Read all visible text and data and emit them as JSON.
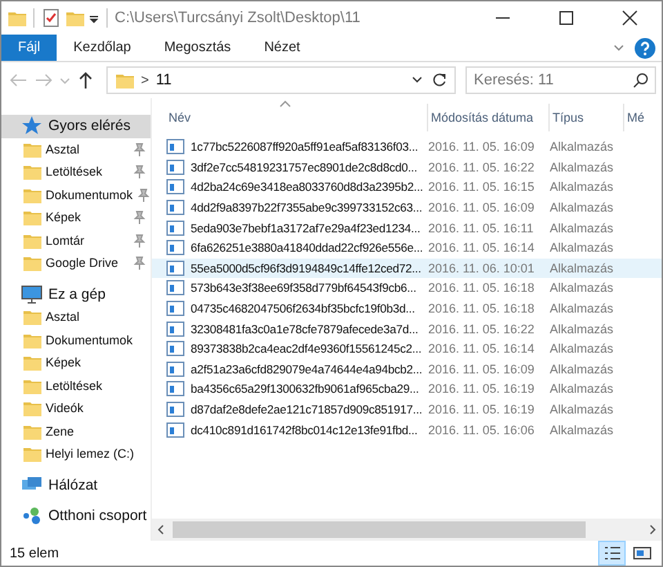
{
  "window": {
    "title": "C:\\Users\\Turcsányi Zsolt\\Desktop\\11"
  },
  "ribbon_tabs": [
    {
      "label": "Fájl",
      "kind": "file"
    },
    {
      "label": "Kezdőlap",
      "kind": "tab"
    },
    {
      "label": "Megosztás",
      "kind": "tab"
    },
    {
      "label": "Nézet",
      "kind": "tab"
    }
  ],
  "address_bar": {
    "separator": ">",
    "path": "11"
  },
  "search": {
    "placeholder": "Keresés: 11"
  },
  "sidebar": {
    "items": [
      {
        "label": "Gyors elérés",
        "selected": true,
        "children": [
          {
            "label": "Asztal",
            "selected": false,
            "pinned": true
          },
          {
            "label": "Letöltések",
            "selected": false,
            "pinned": true
          },
          {
            "label": "Dokumentumok",
            "selected": false,
            "pinned": true
          },
          {
            "label": "Képek",
            "selected": false,
            "pinned": true
          },
          {
            "label": "Lomtár",
            "selected": false,
            "pinned": true
          },
          {
            "label": "Google Drive",
            "selected": false,
            "pinned": true
          }
        ]
      },
      {
        "label": "Ez a gép",
        "selected": false,
        "children": [
          {
            "label": "Asztal",
            "selected": false,
            "pinned": false
          },
          {
            "label": "Dokumentumok",
            "selected": false,
            "pinned": false
          },
          {
            "label": "Képek",
            "selected": false,
            "pinned": false
          },
          {
            "label": "Letöltések",
            "selected": false,
            "pinned": false
          },
          {
            "label": "Videók",
            "selected": false,
            "pinned": false
          },
          {
            "label": "Zene",
            "selected": false,
            "pinned": false
          },
          {
            "label": "Helyi lemez (C:)",
            "selected": false,
            "pinned": false
          }
        ]
      },
      {
        "label": "Hálózat",
        "selected": false
      },
      {
        "label": "Otthoni csoport",
        "selected": false
      }
    ]
  },
  "table": {
    "columns": [
      "Név",
      "Módosítás dátuma",
      "Típus",
      "Mé"
    ],
    "rows": [
      {
        "name": "1c77bc5226087ff920a5ff91eaf5af83136f03...",
        "date": "2016. 11. 05. 16:09",
        "type": "Alkalmazás",
        "selected": false
      },
      {
        "name": "3df2e7cc54819231757ec8901de2c8d8cd0...",
        "date": "2016. 11. 05. 16:22",
        "type": "Alkalmazás",
        "selected": false
      },
      {
        "name": "4d2ba24c69e3418ea8033760d8d3a2395b2...",
        "date": "2016. 11. 05. 16:15",
        "type": "Alkalmazás",
        "selected": false
      },
      {
        "name": "4dd2f9a8397b22f7355abe9c399733152c63...",
        "date": "2016. 11. 05. 16:09",
        "type": "Alkalmazás",
        "selected": false
      },
      {
        "name": "5eda903e7bebf1a3172af7e29a4f23ed1234...",
        "date": "2016. 11. 05. 16:11",
        "type": "Alkalmazás",
        "selected": false
      },
      {
        "name": "6fa626251e3880a41840ddad22cf926e556e...",
        "date": "2016. 11. 05. 16:14",
        "type": "Alkalmazás",
        "selected": false
      },
      {
        "name": "55ea5000d5cf96f3d9194849c14ffe12ced72...",
        "date": "2016. 11. 06. 10:01",
        "type": "Alkalmazás",
        "selected": true
      },
      {
        "name": "573b643e3f38ee69f358d779bf64543f9cb6...",
        "date": "2016. 11. 05. 16:18",
        "type": "Alkalmazás",
        "selected": false
      },
      {
        "name": "04735c4682047506f2634bf35bcfc19f0b3d...",
        "date": "2016. 11. 05. 16:18",
        "type": "Alkalmazás",
        "selected": false
      },
      {
        "name": "32308481fa3c0a1e78cfe7879afecede3a7d...",
        "date": "2016. 11. 05. 16:22",
        "type": "Alkalmazás",
        "selected": false
      },
      {
        "name": "89373838b2ca4eac2df4e9360f15561245c2...",
        "date": "2016. 11. 05. 16:14",
        "type": "Alkalmazás",
        "selected": false
      },
      {
        "name": "a2f51a23a6cfd829079e4a74644e4a94bcb2...",
        "date": "2016. 11. 05. 16:09",
        "type": "Alkalmazás",
        "selected": false
      },
      {
        "name": "ba4356c65a29f1300632fb9061af965cba29...",
        "date": "2016. 11. 05. 16:19",
        "type": "Alkalmazás",
        "selected": false
      },
      {
        "name": "d87daf2e8defe2ae121c71857d909c851917...",
        "date": "2016. 11. 05. 16:19",
        "type": "Alkalmazás",
        "selected": false
      },
      {
        "name": "dc410c891d161742f8bc014c12e13fe91fbd...",
        "date": "2016. 11. 05. 16:06",
        "type": "Alkalmazás",
        "selected": false
      }
    ]
  },
  "status_bar": {
    "count": "15 elem",
    "view_buttons": [
      {
        "selected": true
      },
      {
        "selected": false
      }
    ]
  }
}
